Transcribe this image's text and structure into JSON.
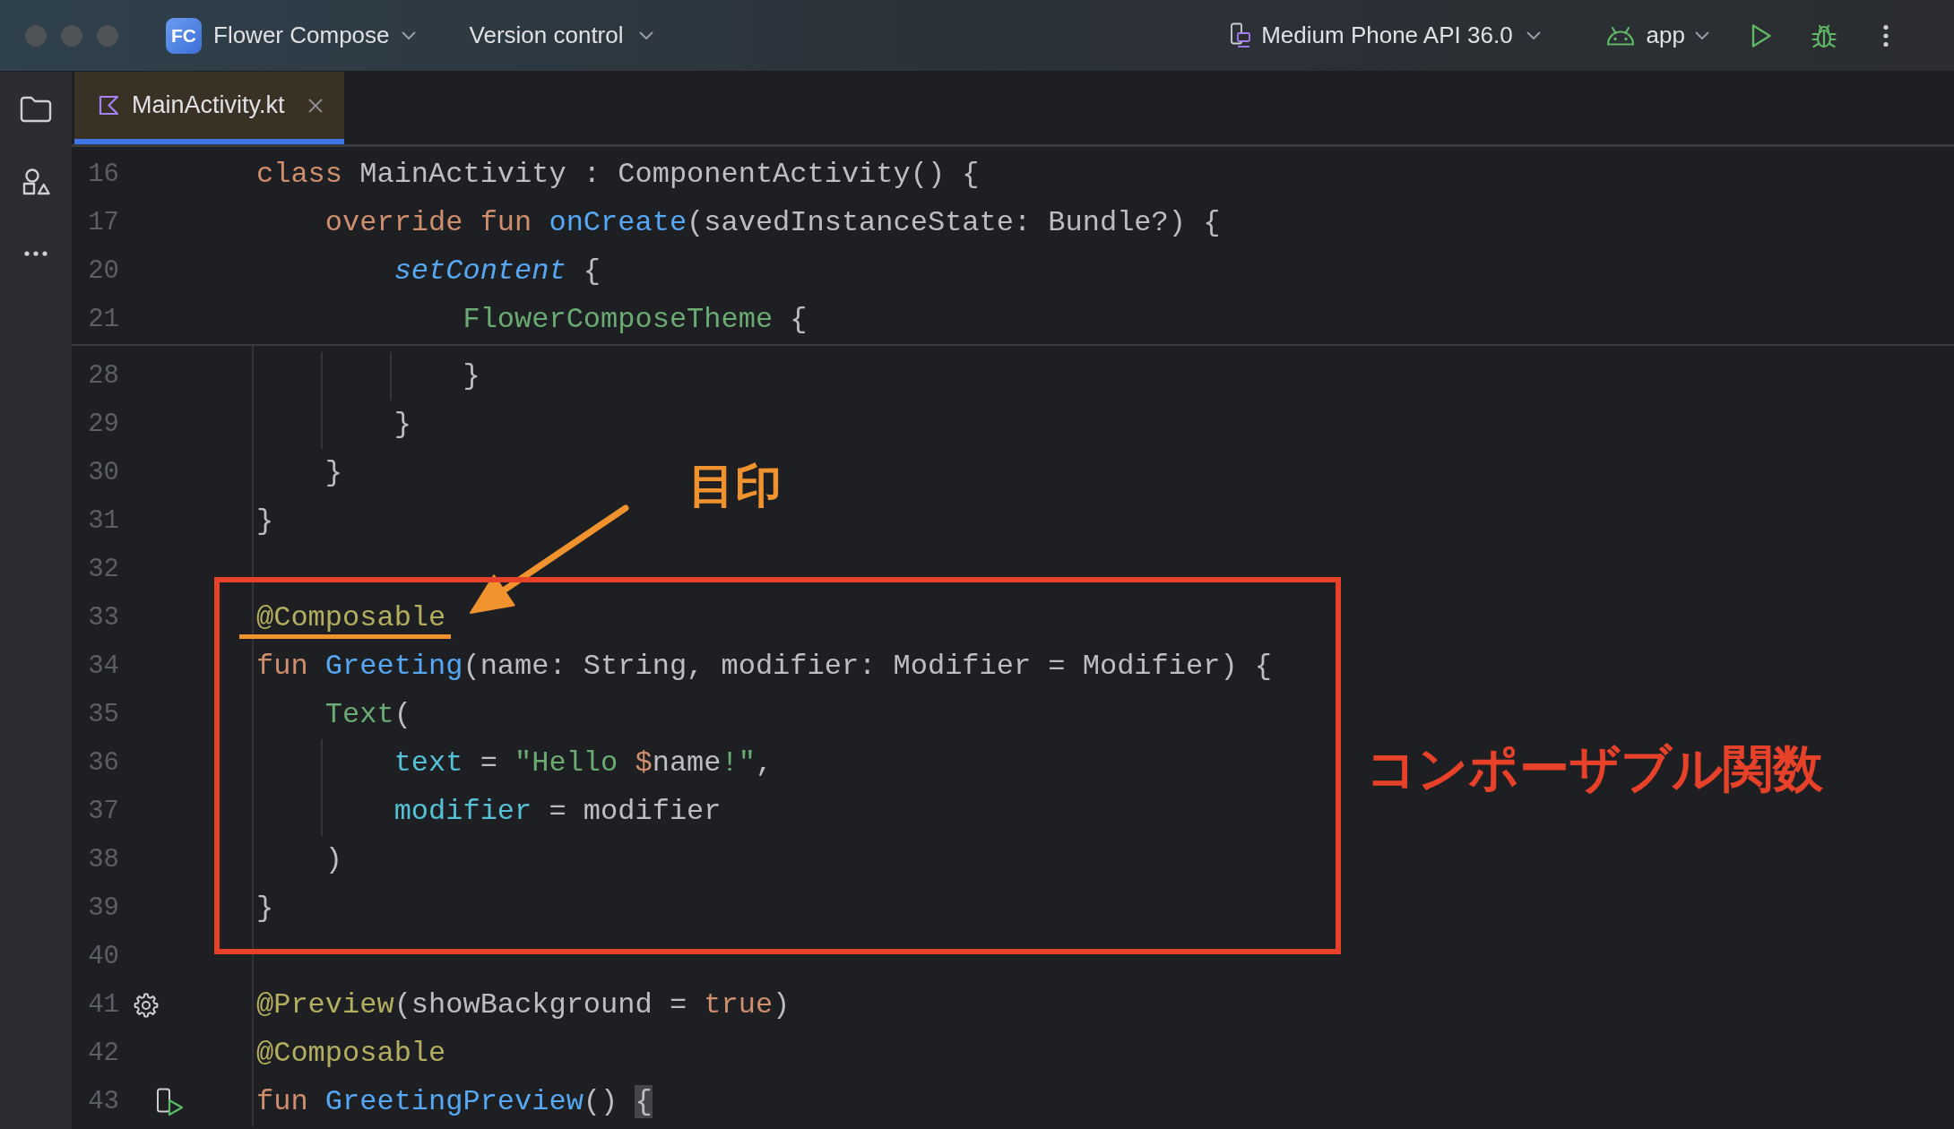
{
  "title_bar": {
    "project_badge": "FC",
    "project": "Flower Compose",
    "vcs": "Version control",
    "device": "Medium Phone API 36.0",
    "run_config": "app"
  },
  "tabs": [
    {
      "label": "MainActivity.kt",
      "selected": true
    }
  ],
  "editor": {
    "sticky_lines": [
      {
        "number": "16",
        "tokens": [
          {
            "kind": "keyword",
            "text": "class"
          },
          {
            "kind": "plain",
            "text": " MainActivity : ComponentActivity() {"
          }
        ]
      },
      {
        "number": "17",
        "tokens": [
          {
            "kind": "keyword",
            "text": "    override fun "
          },
          {
            "kind": "function",
            "text": "onCreate"
          },
          {
            "kind": "plain",
            "text": "(savedInstanceState: Bundle?) {"
          }
        ]
      },
      {
        "number": "20",
        "tokens": [
          {
            "kind": "call",
            "text": "        setContent"
          },
          {
            "kind": "plain",
            "text": " {"
          }
        ]
      },
      {
        "number": "21",
        "tokens": [
          {
            "kind": "composable",
            "text": "            FlowerComposeTheme"
          },
          {
            "kind": "plain",
            "text": " {"
          }
        ]
      }
    ],
    "lines": [
      {
        "kind": "code",
        "number": "28",
        "tokens": [
          {
            "kind": "plain",
            "text": "            }"
          }
        ]
      },
      {
        "kind": "code",
        "number": "29",
        "tokens": [
          {
            "kind": "plain",
            "text": "        }"
          }
        ]
      },
      {
        "kind": "code",
        "number": "30",
        "tokens": [
          {
            "kind": "plain",
            "text": "    }"
          }
        ]
      },
      {
        "kind": "code",
        "number": "31",
        "tokens": [
          {
            "kind": "plain",
            "text": "}"
          }
        ]
      },
      {
        "kind": "code",
        "number": "32"
      },
      {
        "kind": "code",
        "number": "33",
        "tokens": [
          {
            "kind": "annotation",
            "text": "@Composable"
          }
        ]
      },
      {
        "kind": "code",
        "number": "34",
        "tokens": [
          {
            "kind": "keyword",
            "text": "fun "
          },
          {
            "kind": "function",
            "text": "Greeting"
          },
          {
            "kind": "plain",
            "text": "(name: String, modifier: Modifier = Modifier) {"
          }
        ]
      },
      {
        "kind": "code",
        "number": "35",
        "tokens": [
          {
            "kind": "composable",
            "text": "    Text"
          },
          {
            "kind": "plain",
            "text": "("
          }
        ]
      },
      {
        "kind": "code",
        "number": "36",
        "tokens": [
          {
            "kind": "named_arg",
            "text": "        text"
          },
          {
            "kind": "plain",
            "text": " = "
          },
          {
            "kind": "string",
            "text": "\"Hello "
          },
          {
            "kind": "template",
            "text": "$"
          },
          {
            "kind": "plain",
            "text": "name"
          },
          {
            "kind": "string",
            "text": "!\""
          },
          {
            "kind": "plain",
            "text": ","
          }
        ]
      },
      {
        "kind": "code",
        "number": "37",
        "tokens": [
          {
            "kind": "named_arg",
            "text": "        modifier"
          },
          {
            "kind": "plain",
            "text": " = modifier"
          }
        ]
      },
      {
        "kind": "code",
        "number": "38",
        "tokens": [
          {
            "kind": "plain",
            "text": "    )"
          }
        ]
      },
      {
        "kind": "code",
        "number": "39",
        "tokens": [
          {
            "kind": "plain",
            "text": "}"
          }
        ]
      },
      {
        "kind": "code",
        "number": "40"
      },
      {
        "kind": "preview_settings",
        "number": "41",
        "tokens": [
          {
            "kind": "annotation",
            "text": "@Preview"
          },
          {
            "kind": "plain",
            "text": "(showBackground = "
          },
          {
            "kind": "keyword",
            "text": "true"
          },
          {
            "kind": "plain",
            "text": ")"
          }
        ]
      },
      {
        "kind": "code",
        "number": "42",
        "tokens": [
          {
            "kind": "annotation",
            "text": "@Composable"
          }
        ]
      },
      {
        "kind": "preview_entry",
        "number": "43",
        "tokens": [
          {
            "kind": "keyword",
            "text": "fun "
          },
          {
            "kind": "function",
            "text": "GreetingPreview"
          },
          {
            "kind": "plain",
            "text": "() "
          },
          {
            "kind": "matched_brace",
            "text": "{"
          }
        ]
      }
    ]
  },
  "annotations": [
    {
      "kind": "underline",
      "color": "#f0932f"
    },
    {
      "kind": "arrow",
      "color": "#f0932f"
    },
    {
      "kind": "arrow_label",
      "text": "目印",
      "color": "#f0932f"
    },
    {
      "kind": "box",
      "color": "#e8412a"
    },
    {
      "kind": "box_label",
      "text": "コンポーザブル関数",
      "color": "#e8412a"
    }
  ]
}
